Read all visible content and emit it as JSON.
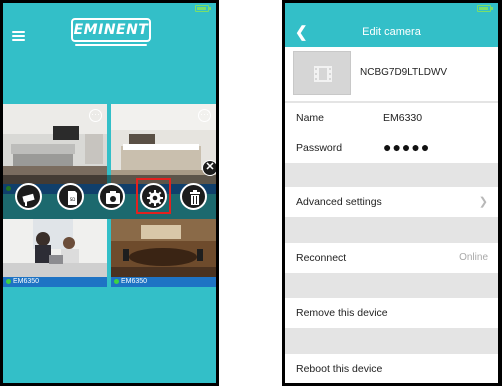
{
  "left_phone": {
    "logo_text": "EMINENT",
    "cameras": [
      {
        "label": "EM6350"
      },
      {
        "label": "EM6350"
      }
    ],
    "actions": [
      {
        "icon": "camera-icon"
      },
      {
        "icon": "sd-card-icon"
      },
      {
        "icon": "snapshot-icon"
      },
      {
        "icon": "gear-icon"
      },
      {
        "icon": "trash-icon"
      }
    ],
    "colors": {
      "accent": "#33bfc8",
      "label_bar": "#1e73c4",
      "highlight": "#e3211e"
    }
  },
  "right_phone": {
    "header": {
      "back_icon": "chevron-left-icon",
      "title": "Edit camera"
    },
    "device": {
      "id": "NCBG7D9LTLDWV"
    },
    "fields": {
      "name_label": "Name",
      "name_value": "EM6330",
      "password_label": "Password",
      "password_value": "●●●●●"
    },
    "menu": {
      "advanced_settings": "Advanced settings",
      "reconnect": "Reconnect",
      "reconnect_status": "Online",
      "remove_device": "Remove this device",
      "reboot_device": "Reboot this device"
    }
  }
}
